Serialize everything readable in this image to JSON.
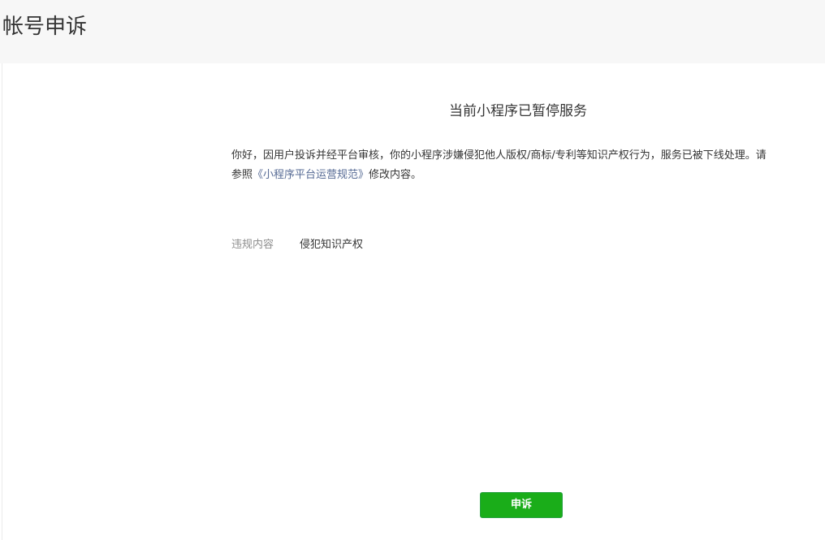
{
  "header": {
    "title": "帐号申诉"
  },
  "notice": {
    "title": "当前小程序已暂停服务",
    "line1": "你好，因用户投诉并经平台审核，你的小程序涉嫌侵犯他人版权/商标/专利等知识产权行为，服务已被下线处理。请",
    "line2_prefix": "参照",
    "rule_link": "《小程序平台运营规范》",
    "line2_suffix": "修改内容。"
  },
  "violation": {
    "label": "违规内容",
    "value": "侵犯知识产权"
  },
  "actions": {
    "appeal_label": "申诉"
  },
  "colors": {
    "header_bg": "#f7f7f7",
    "link": "#576b95",
    "primary_button": "#1aad19",
    "label_gray": "#8d8d8d",
    "text": "#353535"
  }
}
